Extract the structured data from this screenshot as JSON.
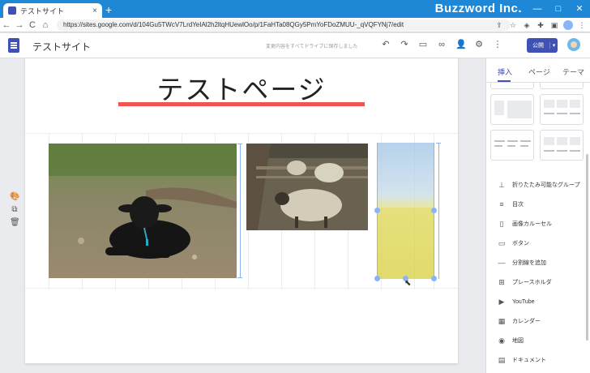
{
  "browser": {
    "tab_title": "テストサイト",
    "tab_close": "×",
    "new_tab": "+",
    "brand_watermark": "Buzzword Inc.",
    "window_buttons": [
      "—",
      "□",
      "✕"
    ],
    "url": "https://sites.google.com/d/104Gu5TWcV7LrdYeIAl2h2ltqHUewlOo/p/1FaHTa08QGy5PmYoFDoZMUU-_qVQFYNj7/edit",
    "nav": {
      "back": "←",
      "forward": "→",
      "reload": "C",
      "home": "⌂",
      "lock": "🔒"
    }
  },
  "site_toolbar": {
    "site_name": "テストサイト",
    "saved_status": "変更内容をすべてドライブに保存しました",
    "publish_label": "公開",
    "publish_dropdown": "▾"
  },
  "canvas": {
    "page_title": "テストページ"
  },
  "side_tools": {
    "palette": "🎨",
    "duplicate": "⧉",
    "delete": "🗑"
  },
  "panel": {
    "tabs": [
      "挿入",
      "ページ",
      "テーマ"
    ],
    "active_tab": "挿入",
    "items": [
      {
        "icon": "expandable-group-icon",
        "glyph": "⊥",
        "label": "折りたたみ可能なグループ"
      },
      {
        "icon": "toc-icon",
        "glyph": "≡",
        "label": "目次"
      },
      {
        "icon": "carousel-icon",
        "glyph": "▯",
        "label": "画像カルーセル"
      },
      {
        "icon": "button-icon",
        "glyph": "▭",
        "label": "ボタン"
      },
      {
        "icon": "divider-icon",
        "glyph": "—",
        "label": "分割線を追加"
      },
      {
        "icon": "placeholder-icon",
        "glyph": "⊞",
        "label": "プレースホルダ"
      },
      {
        "icon": "youtube-icon",
        "glyph": "▶",
        "label": "YouTube"
      },
      {
        "icon": "calendar-icon",
        "glyph": "▦",
        "label": "カレンダー"
      },
      {
        "icon": "map-icon",
        "glyph": "◉",
        "label": "地図"
      },
      {
        "icon": "document-icon",
        "glyph": "▤",
        "label": "ドキュメント"
      }
    ]
  },
  "colors": {
    "tab_strip": "#1e88d6",
    "brand": "#3f51b5",
    "title_underline": "#f25450",
    "selection": "#8ab4f8"
  }
}
